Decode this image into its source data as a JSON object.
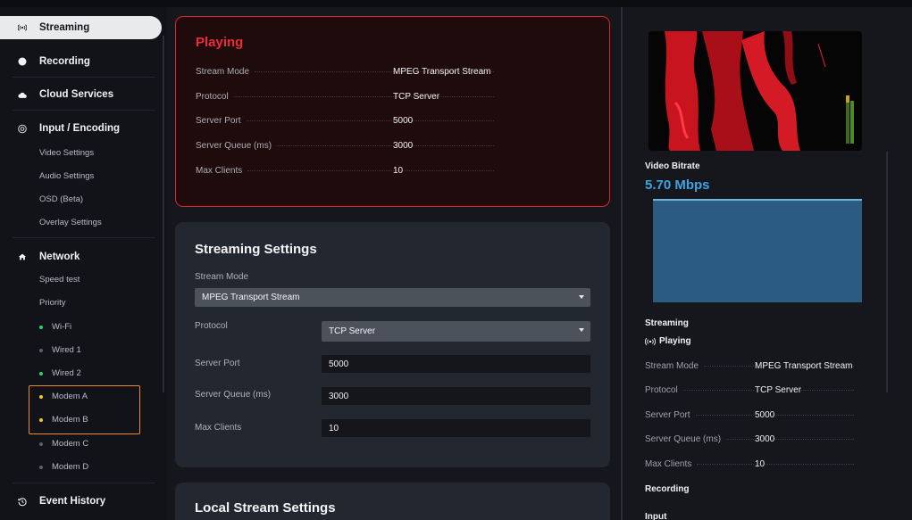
{
  "sidebar": {
    "items": [
      {
        "label": "Streaming",
        "icon": "broadcast-icon"
      },
      {
        "label": "Recording",
        "icon": "record-icon"
      },
      {
        "label": "Cloud Services",
        "icon": "cloud-icon"
      },
      {
        "label": "Input / Encoding",
        "icon": "encoding-icon"
      },
      {
        "label": "Network",
        "icon": "network-icon"
      },
      {
        "label": "Event History",
        "icon": "history-icon"
      }
    ],
    "encoding_sub": [
      "Video Settings",
      "Audio Settings",
      "OSD (Beta)",
      "Overlay Settings"
    ],
    "network_sub": [
      "Speed test",
      "Priority"
    ],
    "network_links": [
      {
        "label": "Wi-Fi",
        "status": "green"
      },
      {
        "label": "Wired 1",
        "status": "gray"
      },
      {
        "label": "Wired 2",
        "status": "green"
      },
      {
        "label": "Modem A",
        "status": "yellow"
      },
      {
        "label": "Modem B",
        "status": "yellow"
      },
      {
        "label": "Modem C",
        "status": "gray"
      },
      {
        "label": "Modem D",
        "status": "gray"
      }
    ]
  },
  "playing": {
    "title": "Playing",
    "rows": [
      {
        "k": "Stream Mode",
        "v": "MPEG Transport Stream"
      },
      {
        "k": "Protocol",
        "v": "TCP Server"
      },
      {
        "k": "Server Port",
        "v": "5000"
      },
      {
        "k": "Server Queue (ms)",
        "v": "3000"
      },
      {
        "k": "Max Clients",
        "v": "10"
      }
    ]
  },
  "settings": {
    "title": "Streaming Settings",
    "stream_mode_label": "Stream Mode",
    "stream_mode_value": "MPEG Transport Stream",
    "protocol_label": "Protocol",
    "protocol_value": "TCP Server",
    "server_port_label": "Server Port",
    "server_port_value": "5000",
    "server_queue_label": "Server Queue (ms)",
    "server_queue_value": "3000",
    "max_clients_label": "Max Clients",
    "max_clients_value": "10"
  },
  "local": {
    "title": "Local Stream Settings"
  },
  "right": {
    "video_bitrate_label": "Video Bitrate",
    "video_bitrate_value": "5.70 Mbps",
    "streaming_head": "Streaming",
    "playing_label": "Playing",
    "rows": [
      {
        "k": "Stream Mode",
        "v": "MPEG Transport Stream"
      },
      {
        "k": "Protocol",
        "v": "TCP Server"
      },
      {
        "k": "Server Port",
        "v": "5000"
      },
      {
        "k": "Server Queue (ms)",
        "v": "3000"
      },
      {
        "k": "Max Clients",
        "v": "10"
      }
    ],
    "recording_head": "Recording",
    "input_head": "Input"
  },
  "colors": {
    "accent_red": "#ea2d37",
    "accent_blue": "#3fa3e2",
    "status_green": "#2bd46a",
    "status_yellow": "#f4c91d",
    "highlight_orange": "#f08a2c"
  }
}
